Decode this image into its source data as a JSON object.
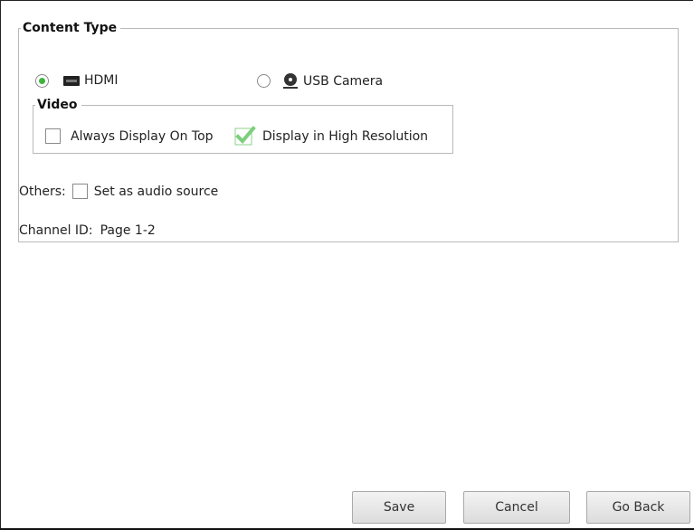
{
  "content_type": {
    "legend": "Content Type",
    "options": [
      {
        "label": "HDMI",
        "selected": true,
        "icon": "hdmi-icon"
      },
      {
        "label": "USB Camera",
        "selected": false,
        "icon": "webcam-icon"
      }
    ]
  },
  "video": {
    "legend": "Video",
    "always_on_top_label": "Always Display On Top",
    "always_on_top_checked": false,
    "high_res_label": "Display in High Resolution",
    "high_res_checked": true
  },
  "others": {
    "label": "Others:",
    "audio_source_label": "Set as audio source",
    "audio_source_checked": false
  },
  "channel": {
    "label": "Channel ID:",
    "value": "Page 1-2"
  },
  "buttons": {
    "save": "Save",
    "cancel": "Cancel",
    "go_back": "Go Back"
  },
  "colors": {
    "radio_selected": "#3fb43f",
    "checkbox_checked": "#7ccf7c"
  }
}
